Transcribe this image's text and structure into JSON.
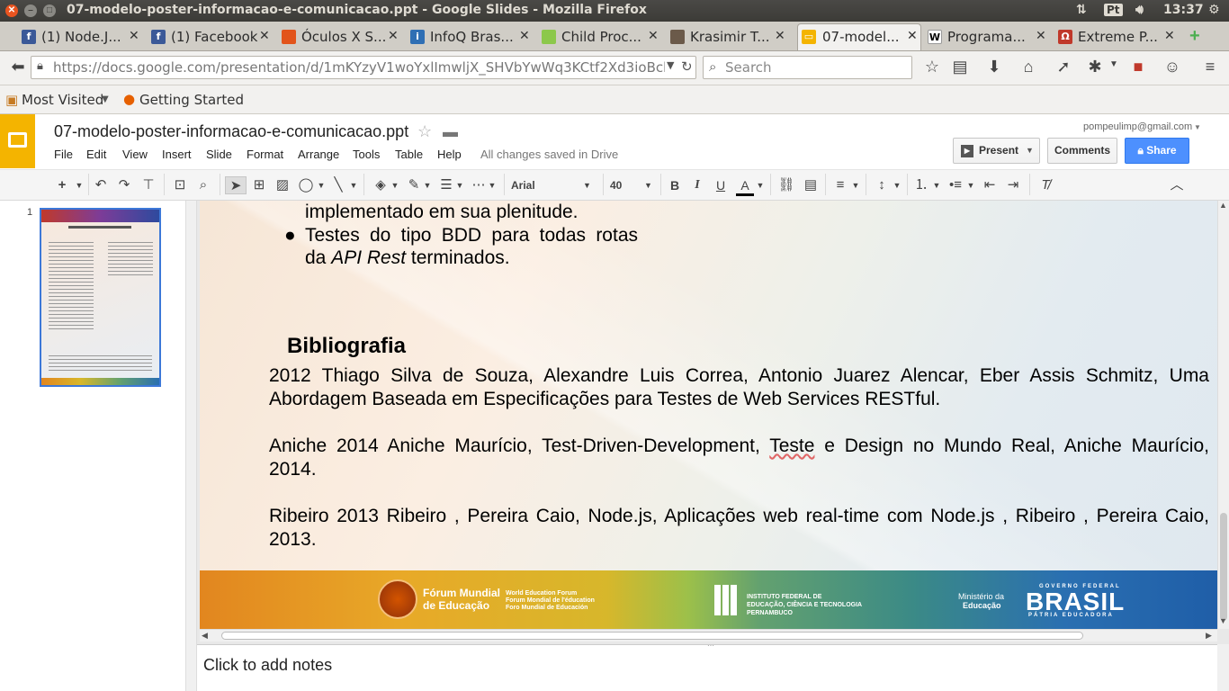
{
  "os": {
    "window_title": "07-modelo-poster-informacao-e-comunicacao.ppt - Google Slides - Mozilla Firefox",
    "keyboard_layout": "Pt",
    "time": "13:37"
  },
  "tabs": [
    {
      "label": "(1) Node.J...",
      "icon": "facebook-icon",
      "color": "#3b5998"
    },
    {
      "label": "(1) Facebook",
      "icon": "facebook-icon",
      "color": "#3b5998"
    },
    {
      "label": "Óculos X S...",
      "icon": "tag-icon",
      "color": "#e2541b"
    },
    {
      "label": "InfoQ Bras...",
      "icon": "infoq-icon",
      "color": "#2f6fb4"
    },
    {
      "label": "Child Proc...",
      "icon": "nodejs-hexagon-icon",
      "color": "#8cc84b"
    },
    {
      "label": "Krasimir T...",
      "icon": "avatar-icon",
      "color": "#6b5a4a"
    },
    {
      "label": "07-model...",
      "icon": "slides-icon",
      "color": "#f4b400",
      "active": true
    },
    {
      "label": "Programa...",
      "icon": "wikipedia-icon",
      "color": "#ffffff"
    },
    {
      "label": "Extreme P...",
      "icon": "omega-icon",
      "color": "#c0392b"
    }
  ],
  "nav": {
    "url_host": "https://docs.google.com",
    "url_path": "/presentation/d/1mKYzyV1woYxlImwljX_SHVbYwWq3KCtf2Xd3ioBckpw/ed",
    "search_placeholder": "Search"
  },
  "bookmarks": {
    "most_visited": "Most Visited",
    "getting_started": "Getting Started"
  },
  "docs": {
    "file_name": "07-modelo-poster-informacao-e-comunicacao.ppt",
    "menus": [
      "File",
      "Edit",
      "View",
      "Insert",
      "Slide",
      "Format",
      "Arrange",
      "Tools",
      "Table",
      "Help"
    ],
    "save_status": "All changes saved in Drive",
    "account": "pompeulimp@gmail.com",
    "present_label": "Present",
    "comments_label": "Comments",
    "share_label": "Share"
  },
  "toolbar": {
    "font": "Arial",
    "font_size": "40"
  },
  "filmstrip": {
    "slide_number": "1"
  },
  "slide": {
    "bullet_line1": "implementado em sua plenitude.",
    "bullet2_line1": "Testes do tipo BDD para todas rotas",
    "bullet2_line2_pre": "da ",
    "bullet2_line2_em": "API Rest",
    "bullet2_line2_post": " terminados.",
    "bib_heading": "Bibliografia",
    "ref1_line1": "2012 Thiago Silva de Souza, Alexandre Luis Correa, Antonio Juarez Alencar, Eber Assis Schmitz, Uma",
    "ref1_line2": "Abordagem Baseada em Especificações para Testes de Web Services RESTful.",
    "ref2_line1_pre": "Aniche 2014 Aniche Maurício, Test-Driven-Development, ",
    "ref2_line1_flag": "Teste",
    "ref2_line1_post": " e Design no Mundo Real, Aniche Maurício,",
    "ref2_line2": "2014.",
    "ref3_line1": "Ribeiro 2013 Ribeiro , Pereira Caio, Node.js, Aplicações web real-time com Node.js , Ribeiro , Pereira Caio,",
    "ref3_line2": "2013.",
    "footer": {
      "forum_line1": "Fórum Mundial",
      "forum_line2": "de Educação",
      "forum_sub1": "World Education Forum",
      "forum_sub2": "Forum Mondial de l'éducation",
      "forum_sub3": "Foro Mundial de Educación",
      "if_line1": "INSTITUTO FEDERAL DE",
      "if_line2": "EDUCAÇÃO, CIÊNCIA E TECNOLOGIA",
      "if_line3": "PERNAMBUCO",
      "min_line1": "Ministério da",
      "min_line2": "Educação",
      "gov_top": "GOVERNO FEDERAL",
      "gov_main": "BRASIL",
      "gov_bottom": "PÁTRIA EDUCADORA"
    }
  },
  "notes_placeholder": "Click to add notes"
}
